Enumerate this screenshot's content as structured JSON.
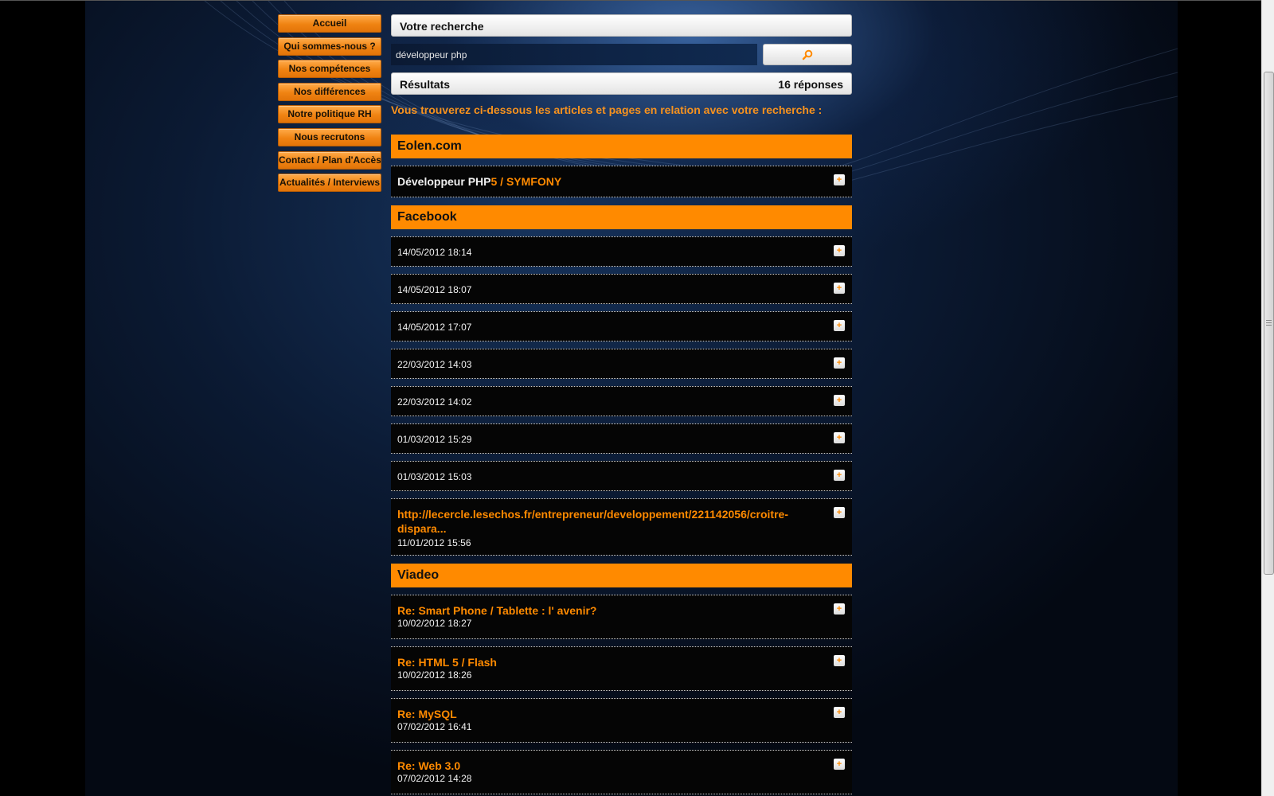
{
  "nav": {
    "items": [
      {
        "label": "Accueil"
      },
      {
        "label": "Qui sommes-nous ?"
      },
      {
        "label": "Nos compétences"
      },
      {
        "label": "Nos différences"
      },
      {
        "label": "Notre politique RH"
      },
      {
        "label": "Nous recrutons"
      },
      {
        "label": "Contact / Plan d'Accès"
      },
      {
        "label": "Actualités / Interviews"
      }
    ]
  },
  "search": {
    "title": "Votre recherche",
    "value": "développeur php",
    "button_icon": "search-icon"
  },
  "results": {
    "title": "Résultats",
    "count": "16 réponses",
    "intro": "Vous trouverez ci-dessous les articles et pages en relation avec votre recherche :"
  },
  "sections": {
    "eolen": {
      "title": "Eolen.com",
      "item": {
        "title_white": "Développeur PHP",
        "title_orange": "5 / SYMFONY"
      }
    },
    "facebook": {
      "title": "Facebook",
      "items": [
        {
          "date": "14/05/2012 18:14"
        },
        {
          "date": "14/05/2012 18:07"
        },
        {
          "date": "14/05/2012 17:07"
        },
        {
          "date": "22/03/2012 14:03"
        },
        {
          "date": "22/03/2012 14:02"
        },
        {
          "date": "01/03/2012 15:29"
        },
        {
          "date": "01/03/2012 15:03"
        }
      ],
      "link_item": {
        "title": "http://lecercle.lesechos.fr/entrepreneur/developpement/221142056/croitre-dispara...",
        "date": "11/01/2012 15:56"
      }
    },
    "viadeo": {
      "title": "Viadeo",
      "items": [
        {
          "title": "Re: Smart Phone / Tablette : l' avenir?",
          "date": "10/02/2012 18:27"
        },
        {
          "title": "Re: HTML 5 / Flash",
          "date": "10/02/2012 18:26"
        },
        {
          "title": "Re: MySQL",
          "date": "07/02/2012 16:41"
        },
        {
          "title": "Re: Web 3.0",
          "date": "07/02/2012 14:28"
        }
      ]
    }
  },
  "expand_symbol": "+",
  "colors": {
    "accent": "#ff8a00",
    "background": "#0b1a33",
    "item_bg": "#050505"
  }
}
